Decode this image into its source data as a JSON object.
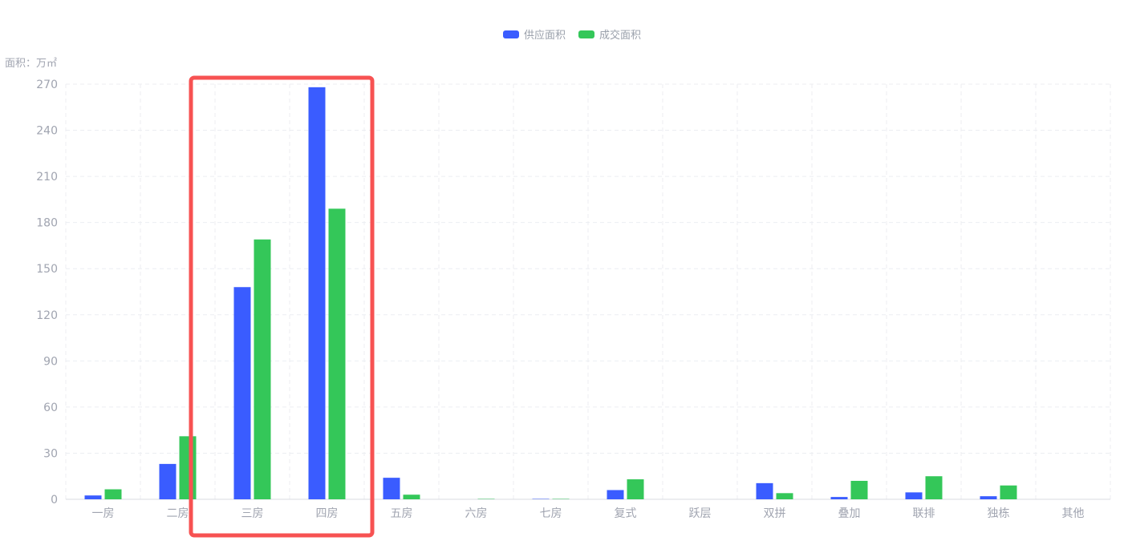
{
  "chart_data": {
    "type": "bar",
    "ylabel": "面积：万㎡",
    "ylim": [
      0,
      270
    ],
    "yticks": [
      0,
      30,
      60,
      90,
      120,
      150,
      180,
      210,
      240,
      270
    ],
    "grid": true,
    "legend_placement": "top-center",
    "categories": [
      "一房",
      "二房",
      "三房",
      "四房",
      "五房",
      "六房",
      "七房",
      "复式",
      "跃层",
      "双拼",
      "叠加",
      "联排",
      "独栋",
      "其他"
    ],
    "series": [
      {
        "name": "供应面积",
        "color": "#3a5cff",
        "values": [
          2.5,
          23,
          138,
          268,
          14,
          0,
          0.5,
          6,
          0,
          10.5,
          1.5,
          4.5,
          2,
          0
        ]
      },
      {
        "name": "成交面积",
        "color": "#34c759",
        "values": [
          6.5,
          41,
          169,
          189,
          3,
          0.3,
          0.3,
          13,
          0,
          4,
          12,
          15,
          9,
          0
        ]
      }
    ],
    "annotations": [
      {
        "type": "highlight-box",
        "categories": [
          "三房",
          "四房"
        ],
        "color": "#f75252"
      }
    ]
  }
}
